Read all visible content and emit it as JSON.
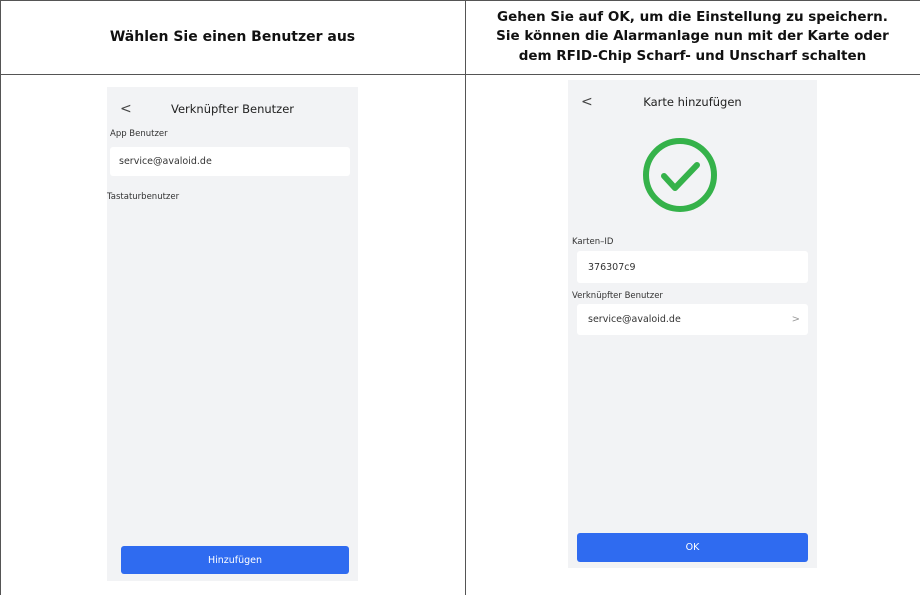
{
  "header": {
    "left": "Wählen Sie einen Benutzer aus",
    "right_line1": "Gehen Sie auf OK, um die Einstellung zu speichern.",
    "right_line2": "Sie können die Alarmanlage nun mit der Karte oder",
    "right_line3": "dem RFID-Chip Scharf- und Unscharf schalten"
  },
  "left_screen": {
    "back_glyph": "<",
    "title": "Verknüpfter Benutzer",
    "app_users_label": "App Benutzer",
    "app_user_value": "service@avaloid.de",
    "keypad_users_label": "Tastaturbenutzer",
    "add_button": "Hinzufügen"
  },
  "right_screen": {
    "back_glyph": "<",
    "title": "Karte hinzufügen",
    "success_icon": "checkmark-circle-icon",
    "success_color": "#35b24a",
    "card_id_label": "Karten–ID",
    "card_id_value": "376307c9",
    "linked_user_label": "Verknüpfter Benutzer",
    "linked_user_value": "service@avaloid.de",
    "chevron_glyph": ">",
    "ok_button": "OK"
  },
  "colors": {
    "accent": "#2f6bf0",
    "screen_bg": "#f2f3f5",
    "table_border": "#555555"
  }
}
